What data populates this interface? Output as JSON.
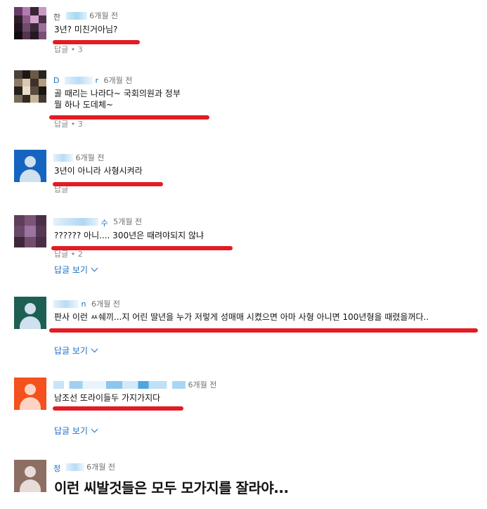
{
  "comments": [
    {
      "author": "한",
      "time": "6개월 전",
      "text": "3년? 미친거아님?",
      "actions": "답글 • 3"
    },
    {
      "author": "D",
      "author_suffix": "r",
      "time": "6개월 전",
      "text_lines": [
        "골 때리는 나라다~ 국회의원과 정부",
        "뭘 하나 도데체~"
      ],
      "actions": "답글 • 3"
    },
    {
      "author": "",
      "time": "6개월 전",
      "text": "3년이 아니라 사형시켜라",
      "actions": "답글"
    },
    {
      "author": "수",
      "time": "5개월 전",
      "text": "??????  아니.... 300년은 때려야되지 않냐",
      "actions": "답글 • 2",
      "replies_link": "답글 보기"
    },
    {
      "author": "n",
      "time": "6개월 전",
      "text": "판사 이런 ㅆ쉐끼...지 어린 딸년을 누가 저렇게 성매매 시켰으면 아마 사형 아니면 100년형을 때렸을꺼다..",
      "replies_link": "답글 보기"
    },
    {
      "author": "",
      "time": "6개월 전",
      "text": "남조선 또라이들두 가지가지다",
      "replies_link": "답글 보기"
    },
    {
      "author": "정",
      "time": "6개월 전",
      "text": "이런 씨발것들은 모두 모가지를 잘라야..."
    }
  ],
  "colors": {
    "highlight": "#e31b23",
    "link": "#1a6fc4",
    "avatar_blue": "#1565c0",
    "avatar_green": "#1e5f53",
    "avatar_orange": "#f4511e",
    "avatar_brown": "#8d6e63"
  }
}
